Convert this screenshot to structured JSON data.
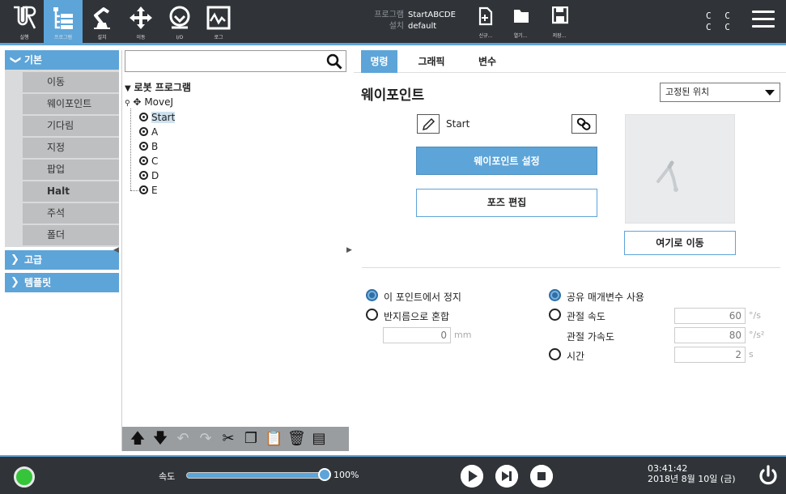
{
  "header": {
    "nav_buttons": [
      {
        "id": "run",
        "label": "실행",
        "icon": "ur-logo-icon"
      },
      {
        "id": "program",
        "label": "프로그램",
        "icon": "program-tree-icon",
        "active": true
      },
      {
        "id": "installation",
        "label": "설치",
        "icon": "robot-arm-icon"
      },
      {
        "id": "move",
        "label": "이동",
        "icon": "move-cross-icon"
      },
      {
        "id": "io",
        "label": "I/O",
        "icon": "io-icon"
      },
      {
        "id": "log",
        "label": "로그",
        "icon": "log-chart-icon"
      }
    ],
    "program_key": "프로그램",
    "program_value": "StartABCDE",
    "installation_key": "설치",
    "installation_value": "default",
    "file_buttons": [
      {
        "id": "new",
        "label": "신규...",
        "icon": "new-file-icon"
      },
      {
        "id": "open",
        "label": "열기...",
        "icon": "folder-icon"
      },
      {
        "id": "save",
        "label": "저장...",
        "icon": "save-disk-icon"
      }
    ],
    "cc_rows": [
      "C C",
      "C C"
    ],
    "accent_color": "#5da4d8"
  },
  "nav": {
    "basic_label": "기본",
    "items": [
      "이동",
      "웨이포인트",
      "기다림",
      "지정",
      "팝업",
      "Halt",
      "주석",
      "폴더"
    ],
    "advanced_label": "고급",
    "templates_label": "템플릿"
  },
  "tree": {
    "search_placeholder": "",
    "root_label": "로봇 프로그램",
    "move_label": "MoveJ",
    "waypoints": [
      "Start",
      "A",
      "B",
      "C",
      "D",
      "E"
    ],
    "selected": "Start"
  },
  "tabs": [
    "명령",
    "그래픽",
    "변수"
  ],
  "waypoint": {
    "title": "웨이포인트",
    "position_type": "고정된 위치",
    "name": "Start",
    "set_button": "웨이포인트 설정",
    "edit_pose_button": "포즈 편집",
    "move_here_button": "여기로 이동",
    "stop_label": "이 포인트에서 정지",
    "blend_label": "반지름으로 혼합",
    "blend_value": "0",
    "blend_unit": "mm",
    "shared_label": "공유 매개변수 사용",
    "joint_speed_label": "관절 속도",
    "joint_speed_value": "60",
    "joint_speed_unit": "°/s",
    "joint_accel_label": "관절 가속도",
    "joint_accel_value": "80",
    "joint_accel_unit": "°/s²",
    "time_label": "시간",
    "time_value": "2",
    "time_unit": "s"
  },
  "footer": {
    "speed_label": "속도",
    "speed_value": "100%",
    "speed_fraction": 1.0,
    "time": "03:41:42",
    "date": "2018년 8월 10일 (금)",
    "status_color": "#36c43a"
  }
}
